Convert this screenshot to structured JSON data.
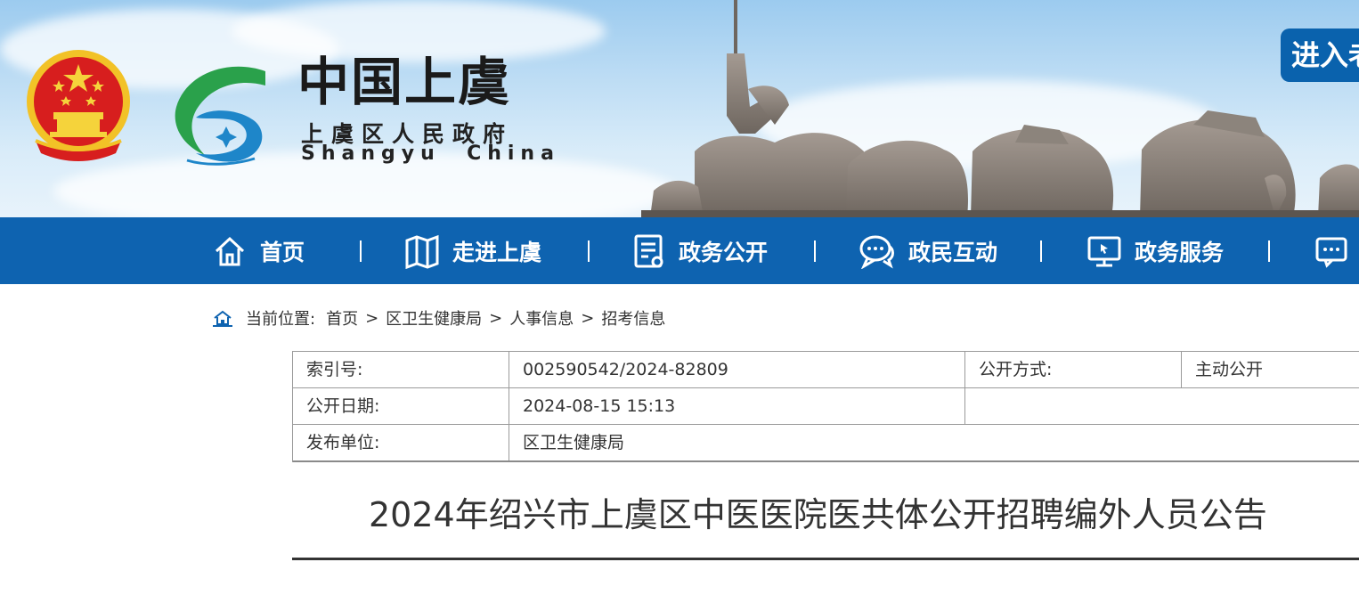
{
  "header": {
    "title_cn": "中国上虞",
    "subtitle_cn": "上虞区人民政府",
    "subtitle_en": "Shangyu  China",
    "enter_label": "进入老",
    "emblem_icon": "national-emblem-icon",
    "logo_icon": "shangyu-logo-icon",
    "colors": {
      "nav": "#0e63b0",
      "button": "#0a62ad"
    }
  },
  "nav": {
    "items": [
      {
        "label": "首页",
        "icon": "home-icon"
      },
      {
        "label": "走进上虞",
        "icon": "map-icon"
      },
      {
        "label": "政务公开",
        "icon": "document-icon"
      },
      {
        "label": "政民互动",
        "icon": "chat-icon"
      },
      {
        "label": "政务服务",
        "icon": "monitor-icon"
      },
      {
        "label": "",
        "icon": "message-icon"
      }
    ]
  },
  "breadcrumb": {
    "prefix": "当前位置:",
    "items": [
      "首页",
      "区卫生健康局",
      "人事信息",
      "招考信息"
    ],
    "separator": ">"
  },
  "meta": {
    "index_label": "索引号:",
    "index_value": "002590542/2024-82809",
    "method_label": "公开方式:",
    "method_value": "主动公开",
    "date_label": "公开日期:",
    "date_value": "2024-08-15 15:13",
    "publisher_label": "发布单位:",
    "publisher_value": "区卫生健康局"
  },
  "article": {
    "title": "2024年绍兴市上虞区中医医院医共体公开招聘编外人员公告"
  }
}
